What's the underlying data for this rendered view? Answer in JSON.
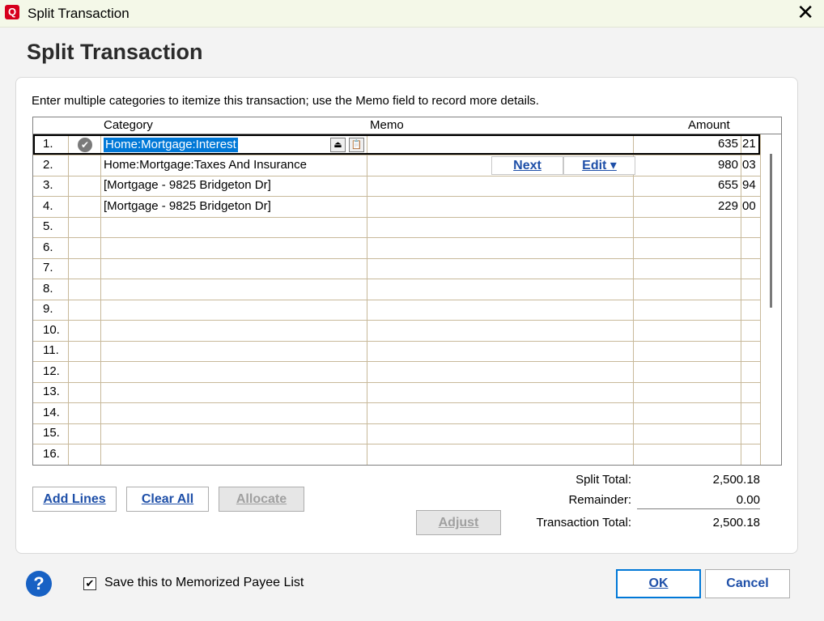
{
  "window": {
    "title": "Split Transaction",
    "app_icon": "Q",
    "close_glyph": "✕"
  },
  "dialog": {
    "heading": "Split Transaction",
    "instructions": "Enter multiple categories to itemize this transaction; use the Memo field to record more details."
  },
  "grid": {
    "headers": {
      "category": "Category",
      "memo": "Memo",
      "amount": "Amount"
    },
    "rows": [
      {
        "num": "1.",
        "category": "Home:Mortgage:Interest",
        "memo": "",
        "amount": "635",
        "cents": "21"
      },
      {
        "num": "2.",
        "category": "Home:Mortgage:Taxes And Insurance",
        "memo": "",
        "amount": "980",
        "cents": "03"
      },
      {
        "num": "3.",
        "category": "[Mortgage - 9825 Bridgeton Dr]",
        "memo": "",
        "amount": "655",
        "cents": "94"
      },
      {
        "num": "4.",
        "category": "[Mortgage - 9825 Bridgeton Dr]",
        "memo": "",
        "amount": "229",
        "cents": "00"
      },
      {
        "num": "5.",
        "category": "",
        "memo": "",
        "amount": "",
        "cents": ""
      },
      {
        "num": "6.",
        "category": "",
        "memo": "",
        "amount": "",
        "cents": ""
      },
      {
        "num": "7.",
        "category": "",
        "memo": "",
        "amount": "",
        "cents": ""
      },
      {
        "num": "8.",
        "category": "",
        "memo": "",
        "amount": "",
        "cents": ""
      },
      {
        "num": "9.",
        "category": "",
        "memo": "",
        "amount": "",
        "cents": ""
      },
      {
        "num": "10.",
        "category": "",
        "memo": "",
        "amount": "",
        "cents": ""
      },
      {
        "num": "11.",
        "category": "",
        "memo": "",
        "amount": "",
        "cents": ""
      },
      {
        "num": "12.",
        "category": "",
        "memo": "",
        "amount": "",
        "cents": ""
      },
      {
        "num": "13.",
        "category": "",
        "memo": "",
        "amount": "",
        "cents": ""
      },
      {
        "num": "14.",
        "category": "",
        "memo": "",
        "amount": "",
        "cents": ""
      },
      {
        "num": "15.",
        "category": "",
        "memo": "",
        "amount": "",
        "cents": ""
      },
      {
        "num": "16.",
        "category": "",
        "memo": "",
        "amount": "",
        "cents": ""
      }
    ],
    "row_buttons": {
      "next": "Next",
      "edit": "Edit ▾"
    },
    "active_row_icon": "✔",
    "mini_buttons": [
      "⏏",
      "📋"
    ]
  },
  "buttons": {
    "add_lines": "Add Lines",
    "clear_all": "Clear All",
    "allocate": "Allocate",
    "adjust": "Adjust",
    "ok": "OK",
    "cancel": "Cancel"
  },
  "totals": {
    "split_total_label": "Split Total:",
    "split_total": "2,500.18",
    "remainder_label": "Remainder:",
    "remainder": "0.00",
    "transaction_total_label": "Transaction Total:",
    "transaction_total": "2,500.18"
  },
  "footer": {
    "help_icon": "?",
    "memorize_label": "Save this to Memorized Payee List",
    "memorize_checked": true,
    "check_glyph": "✔"
  },
  "colors": {
    "selection": "#0078d7",
    "link": "#1e4fa8",
    "grid_line": "#c8b99a"
  }
}
